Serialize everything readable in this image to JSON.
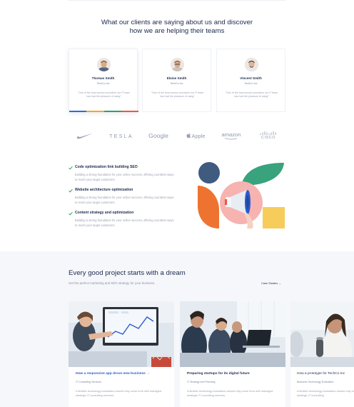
{
  "testimonials": {
    "title_line1": "What our clients are saying about us and discover",
    "title_line2": "how we are helping their teams",
    "cards": [
      {
        "name": "Thomas Smith",
        "company": "TechCo Inc",
        "quote": "\"One of the best service providers our IT team has had the pleasure of using\""
      },
      {
        "name": "Eloise Smith",
        "company": "TechCo Inc",
        "quote": "\"One of the best service providers our IT team has had the pleasure of using\""
      },
      {
        "name": "Vincent Smith",
        "company": "TechCo Inc",
        "quote": "\"One of the best service providers our IT team has had the pleasure of using\""
      }
    ],
    "rainbow_colors": [
      "#2b6cdf",
      "#f5a623",
      "#27a36b",
      "#f0553b"
    ]
  },
  "logos": {
    "nike_icon": "nike-swoosh",
    "tesla": "TESLA",
    "google": "Google",
    "apple": "Apple",
    "amazon": "amazon",
    "cisco": "CISCO"
  },
  "features": [
    {
      "title": "Code optimization link building SEO",
      "desc": "Building a strong foundation for your online success, offering countless ways to reach your target customers."
    },
    {
      "title": "Website architecture optimization",
      "desc": "Building a strong foundation for your online success, offering countless ways to reach your target customers."
    },
    {
      "title": "Content strategy and optimization",
      "desc": "Building a strong foundation for your online success, offering countless ways to reach your target customers."
    }
  ],
  "projects": {
    "title": "Every good project starts with a dream",
    "subtitle": "Get the perfect marketing and SEO strategy for your business.",
    "link": "Case Studies →",
    "cards": [
      {
        "title": "How a responsive app drove new business →",
        "category": "IT Consulting Services",
        "desc": "A flexible technology foundation should only come from well managed strategic IT consulting services."
      },
      {
        "title": "Preparing startups for its digital future",
        "category": "IT Strategy and Planning",
        "desc": "A flexible technology foundation should only come from well managed strategic IT consulting services."
      },
      {
        "title": "How a prototype for TechCo Inc",
        "category": "Business Technology Evaluation",
        "desc": "A flexible technology foundation should only come from well managed strategic IT consulting"
      }
    ]
  },
  "colors": {
    "navy": "#1d2a4d",
    "accent_blue": "#2b5cc9",
    "check_green": "#2ea36b",
    "art_navy": "#3f5b7f",
    "art_green": "#38a37c",
    "art_orange": "#ee7330",
    "art_pink": "#f6b3b0",
    "art_yellow": "#f6cd5a"
  }
}
